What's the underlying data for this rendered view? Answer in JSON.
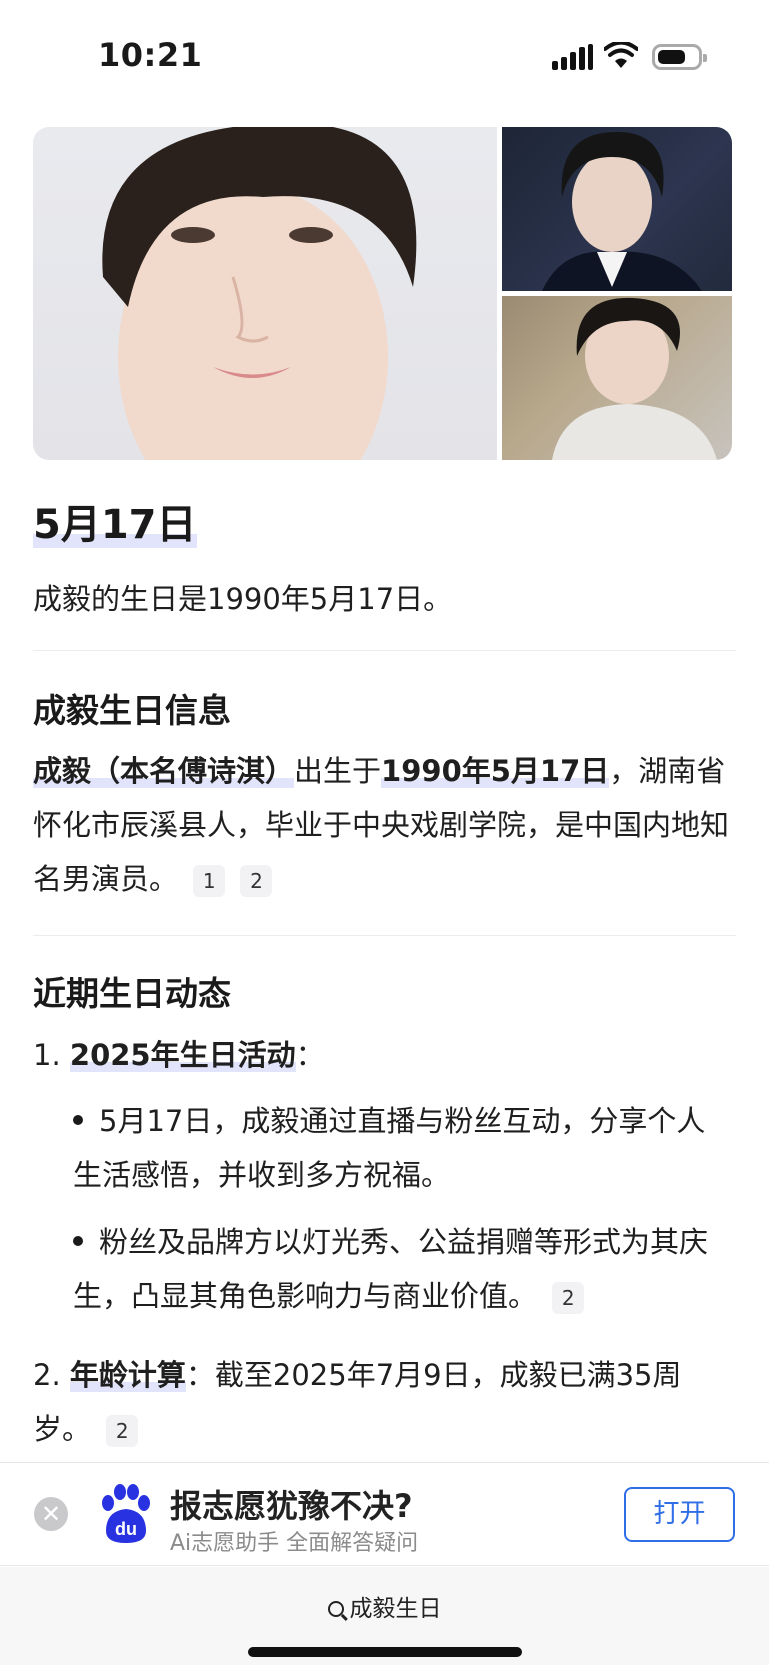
{
  "status_bar": {
    "time": "10:21"
  },
  "answer": {
    "headline": "5月17日",
    "summary": "成毅的生日是1990年5月17日。"
  },
  "section1": {
    "title": "成毅生日信息",
    "name": "成毅（本名傅诗淇）",
    "born_prefix": "出生于",
    "date": "1990年5月17日",
    "rest": "，湖南省怀化市辰溪县人，毕业于中央戏剧学院，是中国内地知名男演员。",
    "refs": [
      "1",
      "2"
    ]
  },
  "section2": {
    "title": "近期生日动态",
    "item1": {
      "number": "1.",
      "label": "2025年生日活动",
      "colon": "：",
      "bullets": [
        {
          "text": "5月17日，成毅通过直播与粉丝互动，分享个人生活感悟，并收到多方祝福。",
          "ref": ""
        },
        {
          "text": "粉丝及品牌方以灯光秀、公益捐赠等形式为其庆生，凸显其角色影响力与商业价值。",
          "ref": "2"
        }
      ]
    },
    "item2": {
      "number": "2.",
      "label": "年龄计算",
      "text": "：截至2025年7月9日，成毅已满35周岁。",
      "ref": "2"
    }
  },
  "banner": {
    "close_glyph": "✕",
    "title": "报志愿犹豫不决?",
    "subtitle": "Ai志愿助手 全面解答疑问",
    "open_label": "打开"
  },
  "bottom": {
    "query": "成毅生日"
  },
  "colors": {
    "accent": "#2f6ee6",
    "highlight": "#e2e4fb",
    "baidu_blue": "#2932e1"
  }
}
